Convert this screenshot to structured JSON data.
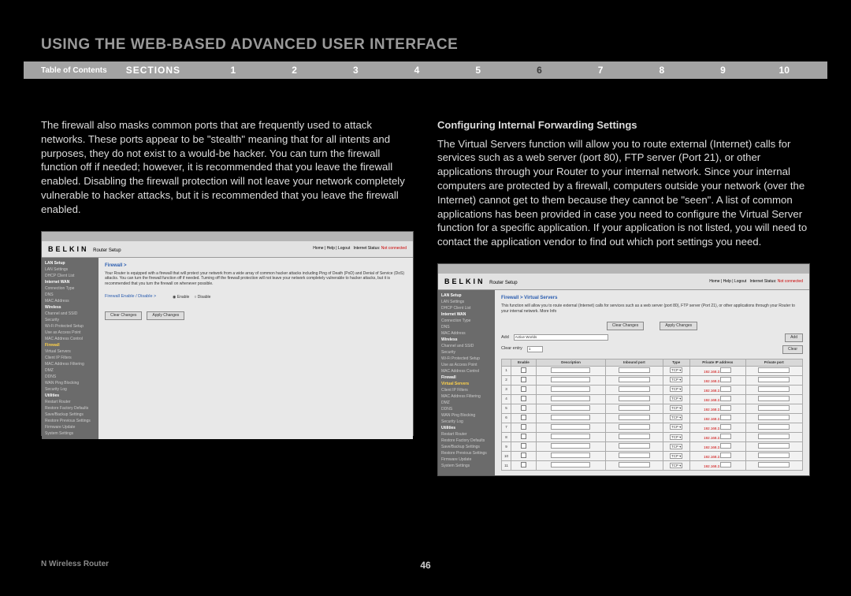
{
  "page": {
    "title": "USING THE WEB-BASED ADVANCED USER INTERFACE",
    "toc_label": "Table of Contents",
    "sections_label": "SECTIONS",
    "section_numbers": [
      "1",
      "2",
      "3",
      "4",
      "5",
      "6",
      "7",
      "8",
      "9",
      "10"
    ],
    "active_section_index": 5,
    "footer_product": "N Wireless Router",
    "page_number": "46"
  },
  "left": {
    "body": "The firewall also masks common ports that are frequently used to attack networks. These ports appear to be \"stealth\" meaning that for all intents and purposes, they do not exist to a would-be hacker. You can turn the firewall function off if needed; however, it is recommended that you leave the firewall enabled. Disabling the firewall protection will not leave your network completely vulnerable to hacker attacks, but it is recommended that you leave the firewall enabled."
  },
  "right": {
    "subhead": "Configuring Internal Forwarding Settings",
    "body": "The Virtual Servers function will allow you to route external (Internet) calls for services such as a web server (port 80), FTP server (Port 21), or other applications through your Router to your internal network. Since your internal computers are protected by a firewall, computers outside your network (over the Internet) cannot get to them because they cannot be \"seen\". A list of common applications has been provided in case you need to configure the Virtual Server function for a specific application. If your application is not listed, you will need to contact the application vendor to find out which port settings you need."
  },
  "screenshot_common": {
    "logo": "BELKIN",
    "logo_sub": "Router Setup",
    "header_links": "Home | Help | Logout",
    "status_label": "Internet Status:",
    "status_value": "Not connected",
    "sidebar": {
      "lan_setup": "LAN Setup",
      "lan_settings": "LAN Settings",
      "dhcp": "DHCP Client List",
      "internet_wan": "Internet WAN",
      "conn_type": "Connection Type",
      "dns": "DNS",
      "mac": "MAC Address",
      "wireless": "Wireless",
      "channel": "Channel and SSID",
      "security": "Security",
      "wps": "Wi-Fi Protected Setup",
      "use_ap": "Use as Access Point",
      "mac_ctrl": "MAC Address Control",
      "firewall": "Firewall",
      "virtual_servers": "Virtual Servers",
      "client_ip": "Client IP Filters",
      "mac_filter": "MAC Address Filtering",
      "dmz": "DMZ",
      "ddns": "DDNS",
      "wan_ping": "WAN Ping Blocking",
      "sec_log": "Security Log",
      "utilities": "Utilities",
      "restart": "Restart Router",
      "factory": "Restore Factory Defaults",
      "save_backup": "Save/Backup Settings",
      "restore_prev": "Restore Previous Settings",
      "firmware": "Firmware Update",
      "system": "System Settings"
    }
  },
  "ss1": {
    "crumb": "Firewall >",
    "desc": "Your Router is equipped with a firewall that will protect your network from a wide array of common hacker attacks including Ping of Death (PoD) and Denial of Service (DoS) attacks. You can turn the firewall function off if needed. Turning off the firewall protection will not leave your network completely vulnerable to hacker attacks, but it is recommended that you turn the firewall on whenever possible.",
    "enable_label": "Firewall Enable / Disable >",
    "opt_enable": "Enable",
    "opt_disable": "Disable",
    "btn_clear": "Clear Changes",
    "btn_apply": "Apply Changes"
  },
  "ss2": {
    "crumb": "Firewall > Virtual Servers",
    "desc": "This function will allow you to route external (Internet) calls for services such as a web server (port 80), FTP server (Port 21), or other applications through your Router to your internal network. More Info",
    "btn_clear": "Clear Changes",
    "btn_apply": "Apply Changes",
    "add_label": "Add",
    "add_value": "Active Worlds",
    "btn_add": "Add",
    "clear_entry_label": "Clear entry",
    "clear_entry_value": "1",
    "btn_entry_clear": "Clear",
    "th_enable": "Enable",
    "th_desc": "Description",
    "th_inbound": "Inbound port",
    "th_type": "Type",
    "th_ip": "Private IP address",
    "th_private": "Private port",
    "type_val": "TCP",
    "ip_prefix": "192.168.2.",
    "row_numbers": [
      "1",
      "2",
      "3",
      "4",
      "5",
      "6",
      "7",
      "8",
      "9",
      "10",
      "11"
    ]
  }
}
